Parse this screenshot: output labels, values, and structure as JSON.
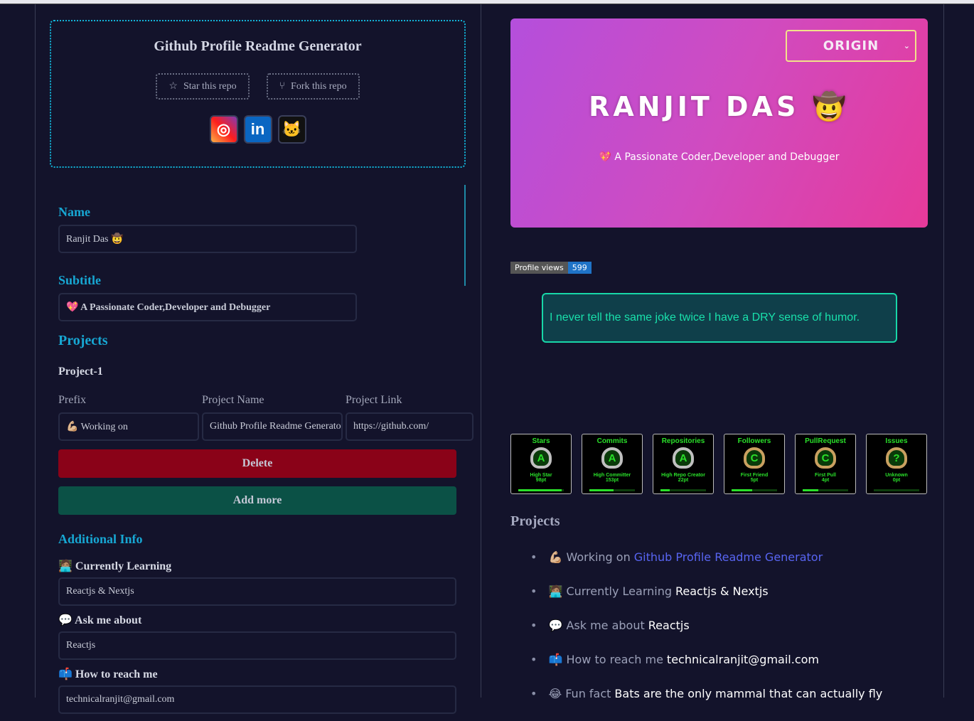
{
  "app": {
    "title": "Github Profile Readme Generator",
    "star_label": "Star this repo",
    "fork_label": "Fork this repo"
  },
  "form": {
    "name_label": "Name",
    "name_value": "Ranjit Das 🤠",
    "subtitle_label": "Subtitle",
    "subtitle_value": "💖 A Passionate Coder,Developer and Debugger",
    "projects_label": "Projects",
    "project_title": "Project-1",
    "columns": [
      "Prefix",
      "Project Name",
      "Project Link"
    ],
    "project": {
      "prefix": "💪🏼 Working on",
      "name": "Github Profile Readme Generator",
      "link": "https://github.com/"
    },
    "delete_label": "Delete",
    "add_label": "Add more",
    "additional_label": "Additional Info",
    "learning_label": "🧑🏽‍💻 Currently Learning",
    "learning_value": "Reactjs & Nextjs",
    "ask_label": "💬 Ask me about",
    "ask_value": "Reactjs",
    "reach_label": "📫 How to reach me",
    "reach_value": "technicalranjit@gmail.com"
  },
  "preview": {
    "theme_select": "ORIGIN",
    "name": "RANJIT DAS 🤠",
    "subtitle": "💖 A Passionate Coder,Developer and Debugger",
    "views_label": "Profile views",
    "views_count": "599",
    "joke": "I never tell the same joke twice I have a DRY sense of humor.",
    "trophies": [
      {
        "title": "Stars",
        "rank": "A",
        "label": "High Star",
        "points": "98pt",
        "progress": 0.95,
        "color": "#c0c0c0"
      },
      {
        "title": "Commits",
        "rank": "A",
        "label": "High Committer",
        "points": "153pt",
        "progress": 0.53,
        "color": "#c0c0c0"
      },
      {
        "title": "Repositories",
        "rank": "A",
        "label": "High Repo Creator",
        "points": "22pt",
        "progress": 0.2,
        "color": "#c0c0c0"
      },
      {
        "title": "Followers",
        "rank": "C",
        "label": "First Friend",
        "points": "5pt",
        "progress": 0.45,
        "color": "#c9a060"
      },
      {
        "title": "PullRequest",
        "rank": "C",
        "label": "First Pull",
        "points": "4pt",
        "progress": 0.35,
        "color": "#c9a060"
      },
      {
        "title": "Issues",
        "rank": "?",
        "label": "Unknown",
        "points": "0pt",
        "progress": 0,
        "color": "#c9a060"
      }
    ],
    "projects_heading": "Projects",
    "items": [
      {
        "prefix": "💪🏼 Working on",
        "value": "Github Profile Readme Generator",
        "link": true
      },
      {
        "prefix": "🧑🏽‍💻 Currently Learning",
        "value": "Reactjs & Nextjs"
      },
      {
        "prefix": "💬 Ask me about",
        "value": "Reactjs"
      },
      {
        "prefix": "📫 How to reach me",
        "value": "technicalranjit@gmail.com"
      },
      {
        "prefix": "😂 Fun fact",
        "value": "Bats are the only mammal that can actually fly"
      }
    ]
  }
}
